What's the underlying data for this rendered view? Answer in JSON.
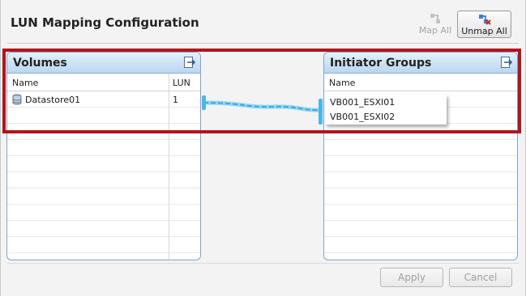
{
  "dialog": {
    "title": "LUN Mapping Configuration"
  },
  "toolbar": {
    "map_all_label": "Map All",
    "unmap_all_label": "Unmap All"
  },
  "volumes": {
    "title": "Volumes",
    "columns": [
      "Name",
      "LUN"
    ],
    "rows": [
      {
        "name": "Datastore01",
        "lun": "1"
      }
    ]
  },
  "initiator_groups": {
    "title": "Initiator Groups",
    "columns": [
      "Name"
    ],
    "items": [
      "VB001_ESXI01",
      "VB001_ESXI02"
    ]
  },
  "footer": {
    "apply_label": "Apply",
    "cancel_label": "Cancel"
  },
  "colors": {
    "panel_border": "#7ba6cd",
    "panel_header": "#b9d6f0",
    "highlight": "#b3141c",
    "connector": "#5bbfe8"
  }
}
